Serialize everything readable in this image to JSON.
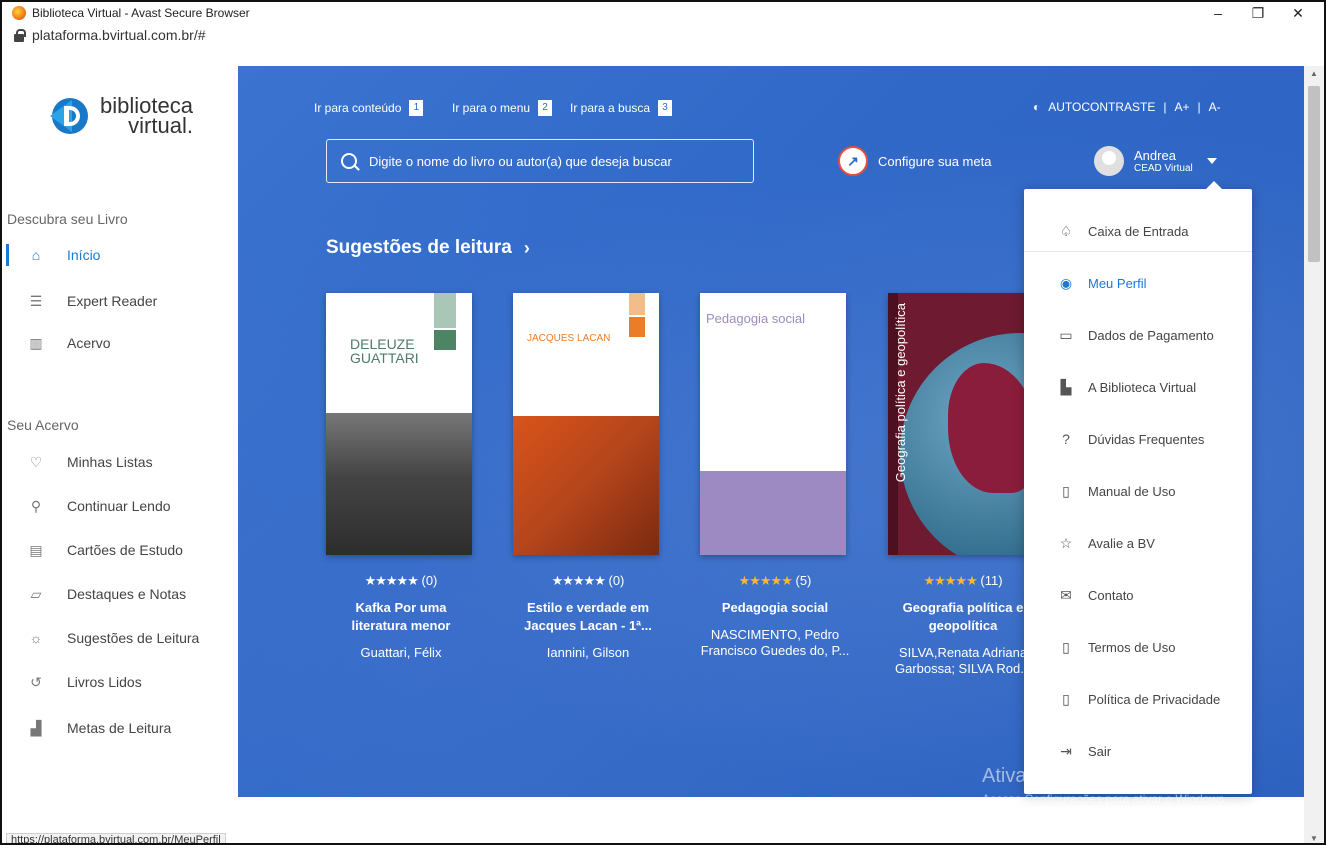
{
  "window": {
    "title": "Biblioteca Virtual - Avast Secure Browser",
    "minimize": "–",
    "restore": "❐",
    "close": "✕"
  },
  "address": {
    "url": "plataforma.bvirtual.com.br/#"
  },
  "logo": {
    "line1": "biblioteca",
    "line2": "virtual."
  },
  "sidebar": {
    "section1": "Descubra seu Livro",
    "items1": [
      {
        "label": "Início",
        "icon": "home-icon"
      },
      {
        "label": "Expert Reader",
        "icon": "list-icon"
      },
      {
        "label": "Acervo",
        "icon": "books-icon"
      }
    ],
    "section2": "Seu Acervo",
    "items2": [
      {
        "label": "Minhas Listas",
        "icon": "heart-icon"
      },
      {
        "label": "Continuar Lendo",
        "icon": "reader-icon"
      },
      {
        "label": "Cartões de Estudo",
        "icon": "card-icon"
      },
      {
        "label": "Destaques e Notas",
        "icon": "note-icon"
      },
      {
        "label": "Sugestões de Leitura",
        "icon": "bulb-icon"
      },
      {
        "label": "Livros Lidos",
        "icon": "history-icon"
      },
      {
        "label": "Metas de Leitura",
        "icon": "chart-icon"
      }
    ]
  },
  "skiplinks": [
    {
      "label": "Ir para conteúdo",
      "num": "1"
    },
    {
      "label": "Ir para o menu",
      "num": "2"
    },
    {
      "label": "Ir para a busca",
      "num": "3"
    }
  ],
  "accessibility": {
    "contrast": "AUTOCONTRASTE",
    "sep": "|",
    "increase": "A+",
    "decrease": "A-"
  },
  "search": {
    "placeholder": "Digite o nome do livro ou autor(a) que deseja buscar"
  },
  "goal": {
    "label": "Configure sua meta"
  },
  "user": {
    "name": "Andrea",
    "org": "CEAD Virtual"
  },
  "section_title": "Sugestões de leitura",
  "books": [
    {
      "title": "Kafka Por uma literatura menor",
      "author": "Guattari, Félix",
      "stars": "★★★★★",
      "rating": "(0)",
      "stars_color": "#ffffff",
      "cover_text": "DELEUZE GUATTARI"
    },
    {
      "title": "Estilo e verdade em Jacques Lacan - 1ª...",
      "author": "Iannini, Gilson",
      "stars": "★★★★★",
      "rating": "(0)",
      "stars_color": "#ffffff",
      "cover_text": "JACQUES LACAN"
    },
    {
      "title": "Pedagogia social",
      "author": "NASCIMENTO, Pedro Francisco Guedes do, P...",
      "stars": "★★★★★",
      "rating": "(5)",
      "stars_color": "#f4b73a",
      "cover_text": "Pedagogia social"
    },
    {
      "title": "Geografia política e geopolítica",
      "author": "SILVA,Renata Adriana Garbossa; SILVA Rod...",
      "stars": "★★★★★",
      "rating": "(11)",
      "stars_color": "#f4b73a",
      "cover_text": "Geografia política e geopolítica"
    }
  ],
  "user_menu": [
    {
      "label": "Caixa de Entrada",
      "icon": "bell-icon",
      "glyph": "🔔"
    },
    {
      "label": "Meu Perfil",
      "icon": "profile-icon",
      "glyph": "◉"
    },
    {
      "label": "Dados de Pagamento",
      "icon": "payment-icon",
      "glyph": "▭"
    },
    {
      "label": "A Biblioteca Virtual",
      "icon": "about-icon",
      "glyph": "■"
    },
    {
      "label": "Dúvidas Frequentes",
      "icon": "help-icon",
      "glyph": "?"
    },
    {
      "label": "Manual de Uso",
      "icon": "manual-icon",
      "glyph": "▯"
    },
    {
      "label": "Avalie a BV",
      "icon": "star-icon",
      "glyph": "☆"
    },
    {
      "label": "Contato",
      "icon": "mail-icon",
      "glyph": "✉"
    },
    {
      "label": "Termos de Uso",
      "icon": "terms-icon",
      "glyph": "▯"
    },
    {
      "label": "Política de Privacidade",
      "icon": "privacy-icon",
      "glyph": "▯"
    },
    {
      "label": "Sair",
      "icon": "logout-icon",
      "glyph": "⇥"
    }
  ],
  "status_url": "https://plataforma.bvirtual.com.br/MeuPerfil",
  "watermark": {
    "line1": "Ativar o Windows",
    "line2": "Acesse Configurações para ativar o Windows."
  },
  "colors": {
    "primary": "#3068c8",
    "accent": "#1a78d6",
    "star_gold": "#f4b73a"
  }
}
